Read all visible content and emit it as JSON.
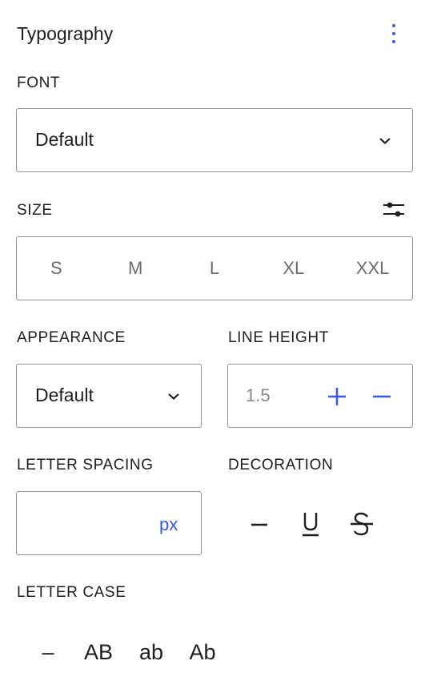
{
  "panel": {
    "title": "Typography",
    "options_icon": "kebab-vertical-icon"
  },
  "font": {
    "label": "FONT",
    "value": "Default"
  },
  "size": {
    "label": "SIZE",
    "options": [
      "S",
      "M",
      "L",
      "XL",
      "XXL"
    ],
    "settings_icon": "sliders-icon"
  },
  "appearance": {
    "label": "APPEARANCE",
    "value": "Default"
  },
  "line_height": {
    "label": "LINE HEIGHT",
    "value": "1.5"
  },
  "letter_spacing": {
    "label": "LETTER SPACING",
    "value": "",
    "unit": "px"
  },
  "decoration": {
    "label": "DECORATION",
    "options": [
      "none-icon",
      "underline-icon",
      "strikethrough-icon"
    ]
  },
  "letter_case": {
    "label": "LETTER CASE",
    "options": [
      "–",
      "AB",
      "ab",
      "Ab"
    ]
  },
  "colors": {
    "accent": "#3858e9",
    "border": "#949494",
    "text": "#1e1e1e"
  }
}
